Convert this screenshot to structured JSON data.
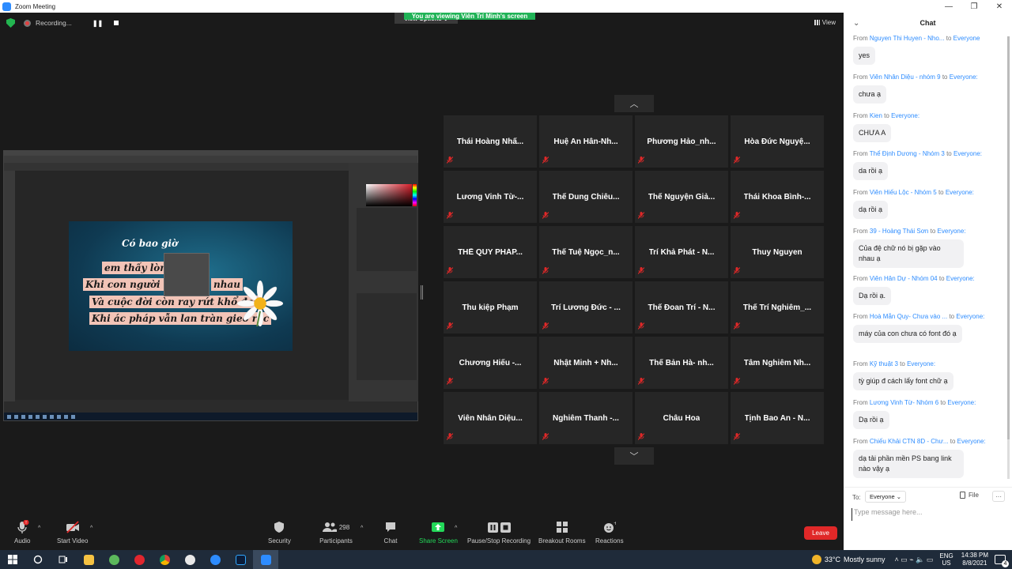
{
  "window": {
    "title": "Zoom Meeting",
    "controls": [
      "—",
      "❐",
      "✕"
    ]
  },
  "banner": {
    "message": "You are viewing Viên Trí Minh's screen",
    "options_label": "View Options ⌄"
  },
  "recording": {
    "label": "Recording...",
    "pause_icon": "❚❚"
  },
  "view_label": "View",
  "shared_screen": {
    "lines": [
      "Có bao giờ",
      "em thấy lòng k",
      "Khi con người chưa",
      "nhau",
      "Và cuộc đời còn ray rứt khổ đau",
      "Khi ác pháp vẫn lan tràn gieo rắc"
    ]
  },
  "gallery": {
    "up_arrow": "︿",
    "down_arrow": "﹀",
    "participants": [
      "Thái Hoàng Nhấ...",
      "Huệ An Hân-Nh...",
      "Phương  Hảo_nh...",
      "Hòa Đức Nguyệ...",
      "Lương Vinh Từ-...",
      "Thế Dung Chiêu...",
      "Thế Nguyện Giả...",
      "Thái Khoa Bình-...",
      "THẾ QUY PHÁP...",
      "Thế Tuệ Ngọc_n...",
      "Trí Khả Phát - N...",
      "Thuy Nguyen",
      "Thu kiệp Phạm",
      "Trí Lương Đức - ...",
      "Thế Đoan Trí - N...",
      "Thế Trí Nghiêm_...",
      "Chương  Hiếu  -...",
      "Nhật Minh + Nh...",
      "Thế Bản Hà- nh...",
      "Tâm Nghiêm Nh...",
      "Viên  Nhân Diệu...",
      "Nghiêm Thanh -...",
      "Châu Hoa",
      "Tịnh Bao An - N..."
    ]
  },
  "toolbar": {
    "audio": "Audio",
    "audio_badge": "!",
    "start_video": "Start Video",
    "security": "Security",
    "participants": "Participants",
    "participant_count": "298",
    "chat": "Chat",
    "share_screen": "Share Screen",
    "pause_recording": "Pause/Stop Recording",
    "breakout_rooms": "Breakout Rooms",
    "reactions": "Reactions",
    "leave": "Leave"
  },
  "chat": {
    "title": "Chat",
    "messages": [
      {
        "from": "Nguyen Thi Huyen - Nho...",
        "to": "Everyone",
        "text": "yes"
      },
      {
        "from": "Viên Nhân Diệu - nhóm 9",
        "to": "Everyone:",
        "text": "chưa ạ"
      },
      {
        "from": "Kien",
        "to": "Everyone:",
        "text": "CHƯA A"
      },
      {
        "from": "Thể Định Dương - Nhóm 3",
        "to": "Everyone:",
        "text": "da rồi ạ"
      },
      {
        "from": "Viên Hiếu Lộc - Nhóm 5",
        "to": "Everyone:",
        "text": "dạ rồi ạ"
      },
      {
        "from": "39 - Hoàng Thái Sơn",
        "to": "Everyone:",
        "text": "Của đệ chữ nó bị gặp vào nhau ạ"
      },
      {
        "from": "Viên Hân Dự - Nhóm 04",
        "to": "Everyone:",
        "text": "Dạ rồi ạ."
      },
      {
        "from": "Hoà Mẫn Quy- Chưa vào ...",
        "to": "Everyone:",
        "text": "máy của con chưa có font đó ạ"
      },
      {
        "from": "Kỹ thuật 3",
        "to": "Everyone:",
        "text": "tỳ giúp đ cách lấy font chữ ạ"
      },
      {
        "from": "Lương Vinh Từ- Nhóm 6",
        "to": "Everyone:",
        "text": "Dạ rồi ạ"
      },
      {
        "from": "Chiếu Khải CTN 8D - Chư...",
        "to": "Everyone:",
        "text": "dạ tải phần mền PS bang link nào vậy ạ"
      }
    ],
    "from_word": "From",
    "to_word": "to",
    "to_label": "To:",
    "to_value": "Everyone ⌄",
    "file_label": "File",
    "more_label": "···",
    "input_placeholder": "Type message here..."
  },
  "taskbar": {
    "temperature": "33°C",
    "weather": "Mostly sunny",
    "lang_1": "ENG",
    "lang_2": "US",
    "time": "14:38 PM",
    "date": "8/8/2021",
    "notification_count": "4"
  },
  "colors": {
    "zoom_blue": "#2d8cff",
    "green": "#23d959",
    "leave_red": "#e02828"
  }
}
